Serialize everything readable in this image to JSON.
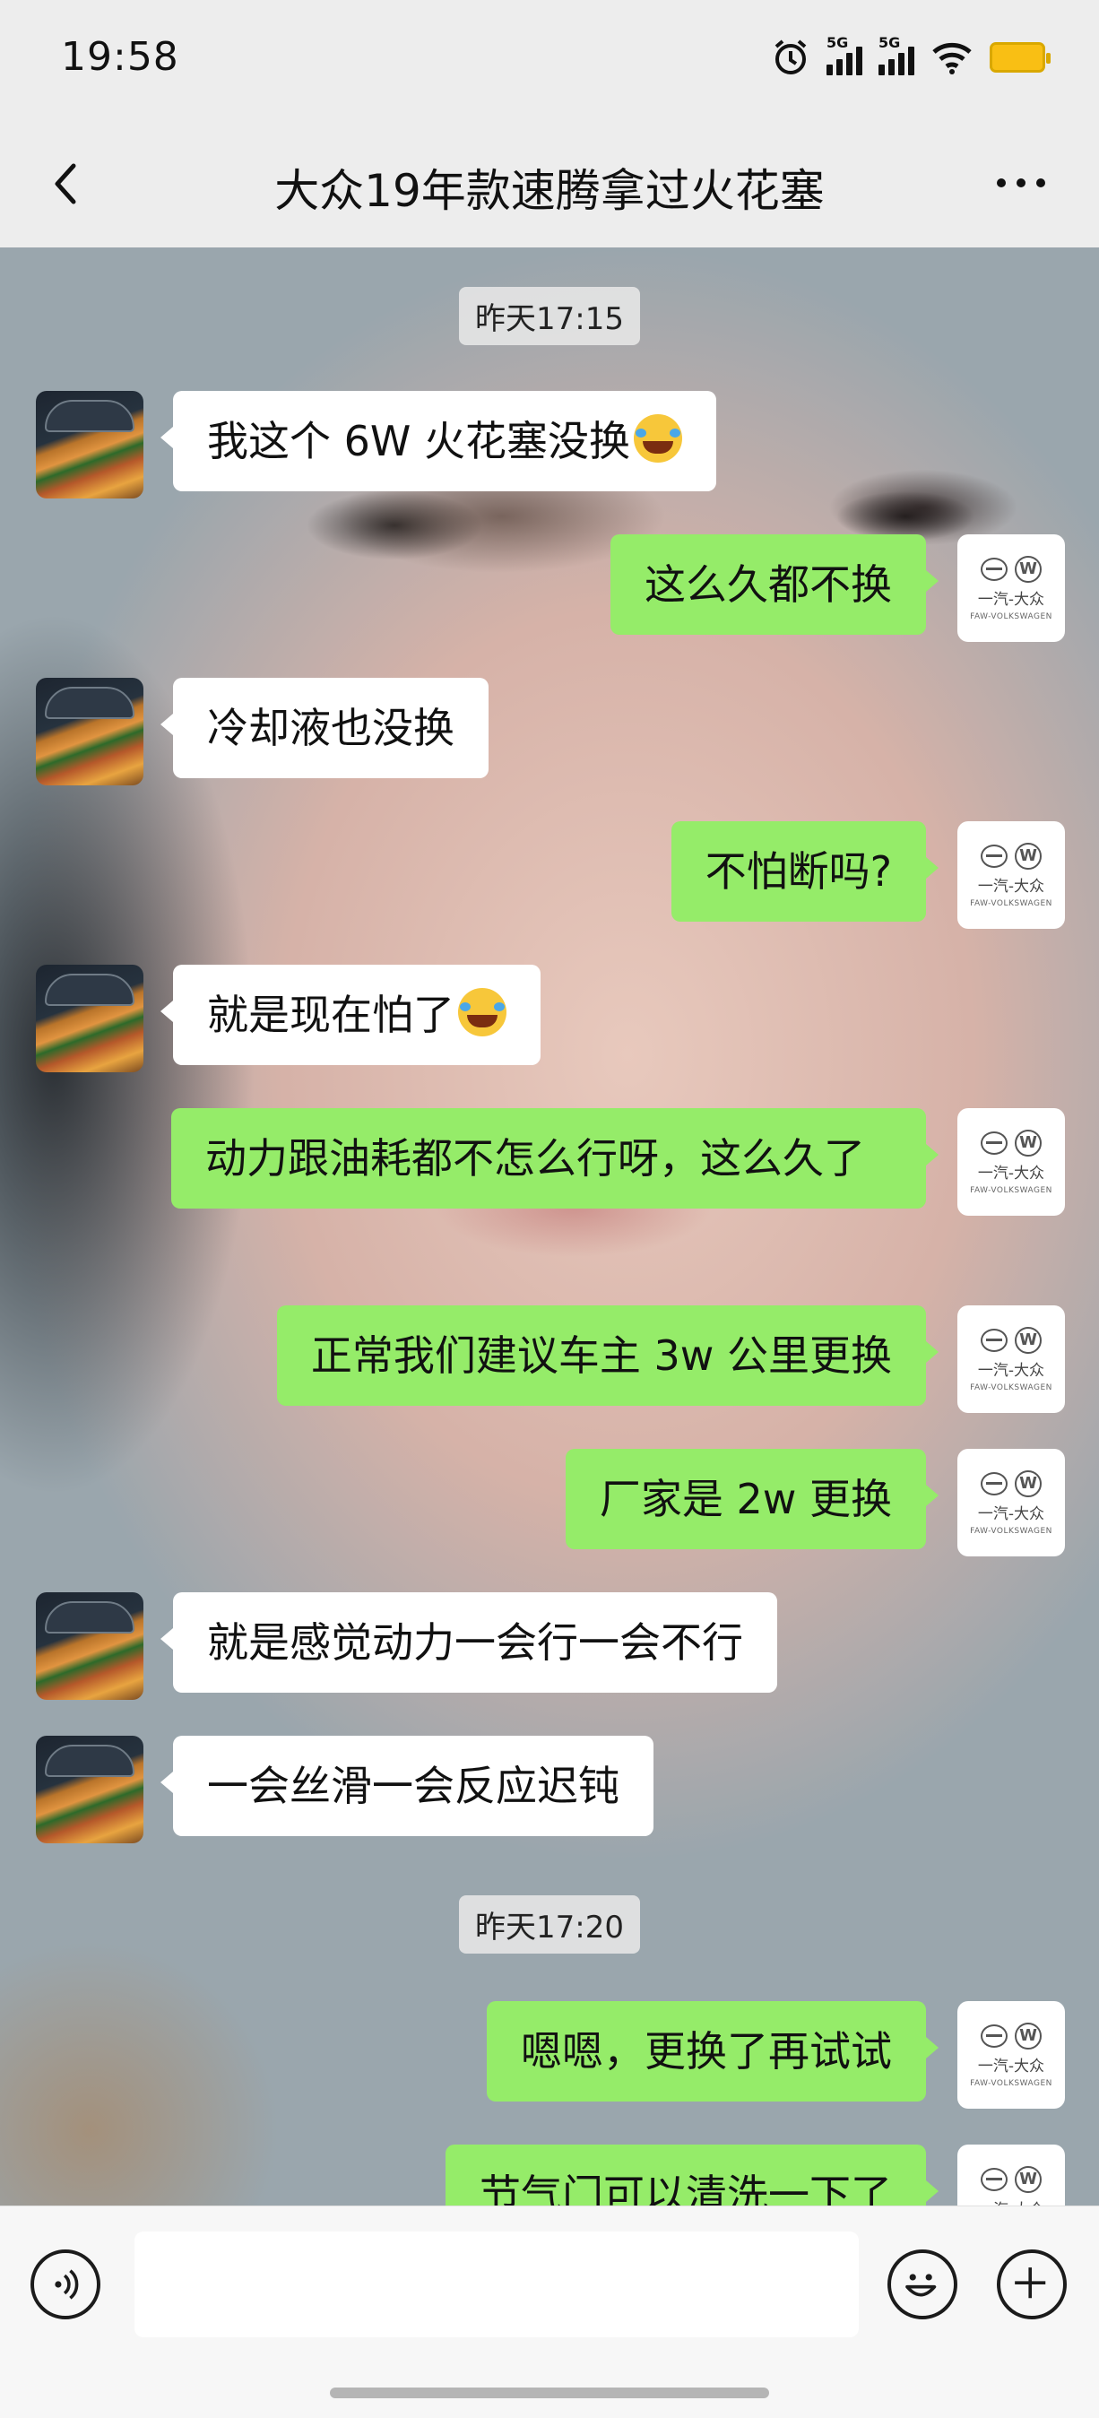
{
  "status_bar": {
    "time": "19:58",
    "net1": "5G",
    "net2": "5G"
  },
  "header": {
    "title": "大众19年款速腾拿过火花塞"
  },
  "timestamps": [
    "昨天17:15",
    "昨天17:20"
  ],
  "messages": [
    {
      "side": "left",
      "text": "我这个 6W 火花塞没换",
      "emoji": true
    },
    {
      "side": "right",
      "text": "这么久都不换"
    },
    {
      "side": "left",
      "text": "冷却液也没换"
    },
    {
      "side": "right",
      "text": "不怕断吗?"
    },
    {
      "side": "left",
      "text": "就是现在怕了",
      "emoji": true
    },
    {
      "side": "right",
      "text": "动力跟油耗都不怎么行呀，这么久了"
    },
    {
      "side": "right",
      "text": "正常我们建议车主 3w 公里更换"
    },
    {
      "side": "right",
      "text": "厂家是 2w 更换"
    },
    {
      "side": "left",
      "text": "就是感觉动力一会行一会不行"
    },
    {
      "side": "left",
      "text": "一会丝滑一会反应迟钝"
    },
    {
      "side": "right",
      "text": "嗯嗯，更换了再试试"
    },
    {
      "side": "right",
      "text": "节气门可以清洗一下了"
    }
  ],
  "avatar_right": {
    "cn": "一汽-大众",
    "en": "FAW-VOLKSWAGEN"
  },
  "colors": {
    "sent_bubble": "#95ec69",
    "received_bubble": "#ffffff",
    "background": "#ededed"
  },
  "icons": {
    "voice": "voice-icon",
    "emoji": "emoji-icon",
    "plus": "plus-icon",
    "back": "back-arrow-icon",
    "more": "more-icon"
  }
}
